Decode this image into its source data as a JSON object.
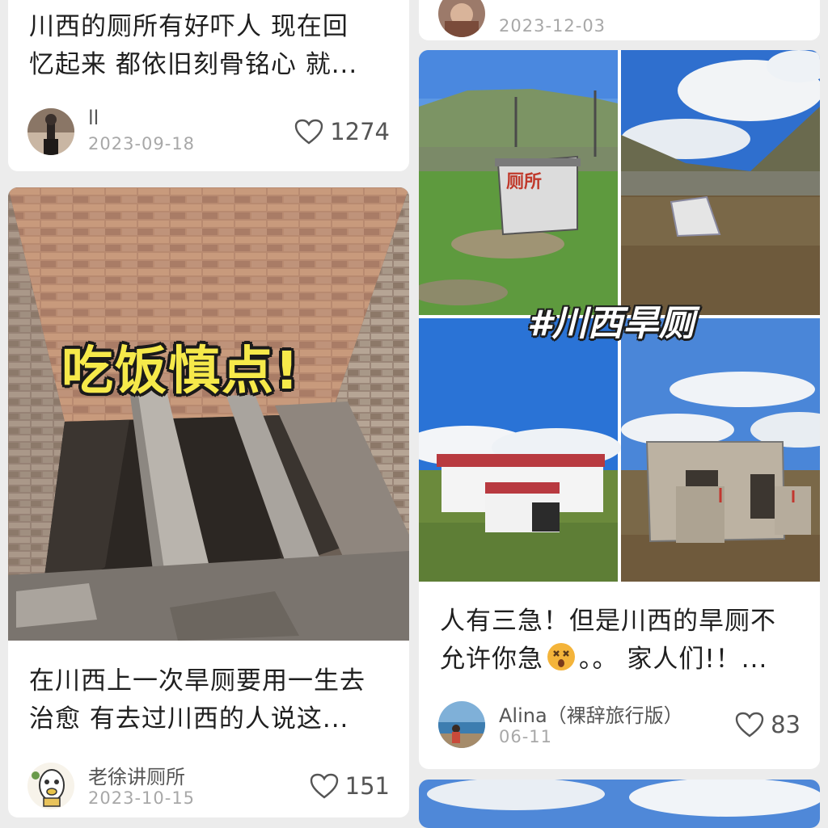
{
  "left_column": {
    "card1": {
      "title_line1": "川西的厕所有好吓人 现在回",
      "title_line2": "忆起来 都依旧刻骨铭心 就...",
      "author": "ll",
      "date": "2023-09-18",
      "likes": "1274",
      "avatar_icon": "avatar-person-icon"
    },
    "card2": {
      "image_overlay": "吃饭慎点!",
      "title_line1": "在川西上一次旱厕要用一生去",
      "title_line2": "治愈 有去过川西的人说这...",
      "author": "老徐讲厕所",
      "date": "2023-10-15",
      "likes": "151",
      "avatar_icon": "avatar-cartoon-icon"
    }
  },
  "right_column": {
    "card0": {
      "date": "2023-12-03",
      "avatar_icon": "avatar-person-icon"
    },
    "card1": {
      "image_hashtag": "#川西旱厕",
      "image_sign_text": "厕所",
      "title_line1": "人有三急！但是川西的旱厕不",
      "title_line2_part1": "允许你急",
      "emoji": "dizzy-face-emoji",
      "title_line2_part2": "。。 家人们!！...",
      "author": "Alina（裸辞旅行版）",
      "date": "06-11",
      "likes": "83",
      "avatar_icon": "avatar-landscape-icon"
    }
  },
  "colors": {
    "background": "#ececec",
    "card": "#ffffff",
    "overlay_text_fill": "#f6e94a",
    "sky": "#3d7fd9"
  }
}
